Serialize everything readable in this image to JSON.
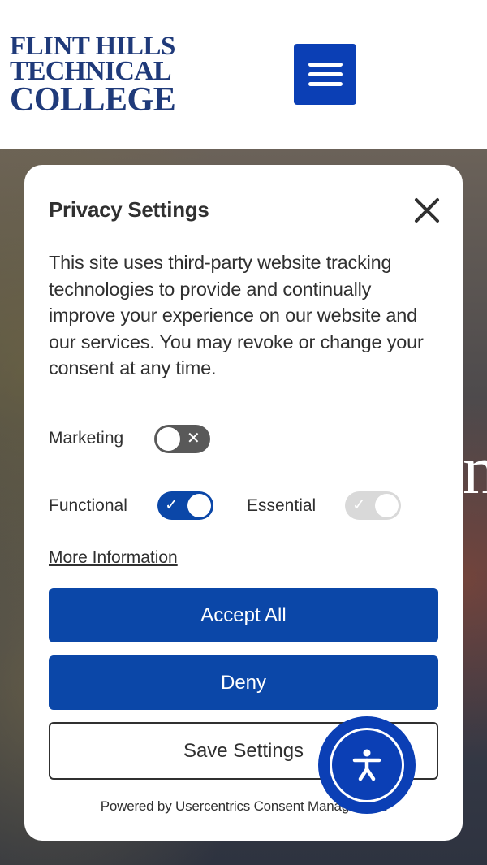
{
  "header": {
    "logo_line1": "FLINT HILLS",
    "logo_line2": "TECHNICAL",
    "logo_line3": "COLLEGE",
    "menu_icon": "hamburger-menu-icon"
  },
  "hero": {
    "partial_text": "n"
  },
  "privacy_dialog": {
    "title": "Privacy Settings",
    "close_icon": "close-icon",
    "description": "This site uses third-party website tracking technologies to provide and continually improve your experience on our website and our services. You may revoke or change your consent at any time.",
    "toggles": [
      {
        "label": "Marketing",
        "enabled": false,
        "disabled": false
      },
      {
        "label": "Functional",
        "enabled": true,
        "disabled": false
      },
      {
        "label": "Essential",
        "enabled": true,
        "disabled": true
      }
    ],
    "more_info_link": "More Information",
    "accept_all_label": "Accept All",
    "deny_label": "Deny",
    "save_settings_label": "Save Settings",
    "powered_by": "Powered by Usercentrics Consent Management"
  },
  "accessibility_button": {
    "icon": "accessibility-icon"
  },
  "colors": {
    "brand_blue": "#0b3fb5",
    "button_blue": "#0b47a8",
    "logo_blue": "#1f3a7a",
    "text_dark": "#303030"
  }
}
